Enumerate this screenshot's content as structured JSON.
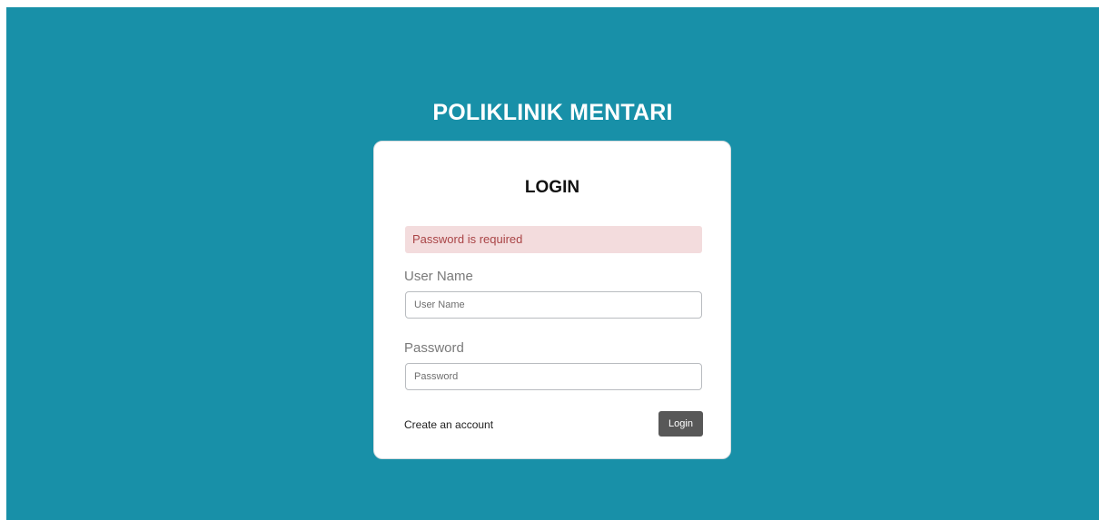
{
  "app": {
    "title": "POLIKLINIK MENTARI"
  },
  "login_form": {
    "heading": "LOGIN",
    "error_message": "Password is required",
    "username": {
      "label": "User Name",
      "placeholder": "User Name",
      "value": ""
    },
    "password": {
      "label": "Password",
      "placeholder": "Password",
      "value": ""
    },
    "create_account_link": "Create an account",
    "submit_label": "Login"
  },
  "colors": {
    "background": "#1890a8",
    "card": "#ffffff",
    "alert_background": "#f3dcdd",
    "alert_text": "#a94446",
    "button": "#585858"
  }
}
